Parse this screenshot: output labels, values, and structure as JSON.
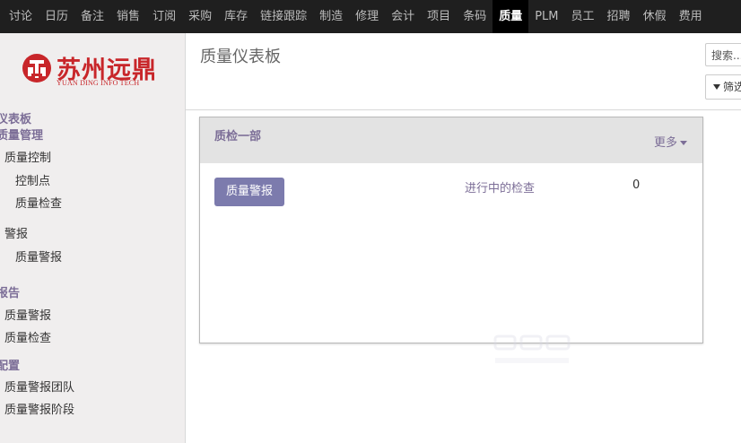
{
  "topnav": {
    "items": [
      "讨论",
      "日历",
      "备注",
      "销售",
      "订阅",
      "采购",
      "库存",
      "链接跟踪",
      "制造",
      "修理",
      "会计",
      "项目",
      "条码",
      "质量",
      "PLM",
      "员工",
      "招聘",
      "休假",
      "费用"
    ],
    "active": "质量"
  },
  "logo": {
    "name_cn": "苏州远鼎",
    "name_en": "YUAN DING INFO TECH",
    "brand_color": "#c8262a"
  },
  "sidebar": {
    "section_dashboard": "仪表板",
    "section_quality_mgmt": "质量管理",
    "quality_control": "质量控制",
    "control_points": "控制点",
    "quality_checks": "质量检查",
    "alerts": "警报",
    "quality_alerts": "质量警报",
    "section_reports": "报告",
    "report_alerts": "质量警报",
    "report_checks": "质量检查",
    "section_config": "配置",
    "alert_teams": "质量警报团队",
    "alert_stages": "质量警报阶段"
  },
  "control_panel": {
    "title": "质量仪表板",
    "search_placeholder": "搜索...",
    "filter_label": "筛选"
  },
  "team_card": {
    "title": "质检一部",
    "more_label": "更多",
    "alert_button": "质量警报",
    "in_progress_label": "进行中的检查",
    "in_progress_count": "0"
  },
  "colors": {
    "topbar": "#1f1f1f",
    "accent_purple": "#7c6e97",
    "button": "#7c7bad",
    "sidebar_bg": "#f0eeee"
  }
}
